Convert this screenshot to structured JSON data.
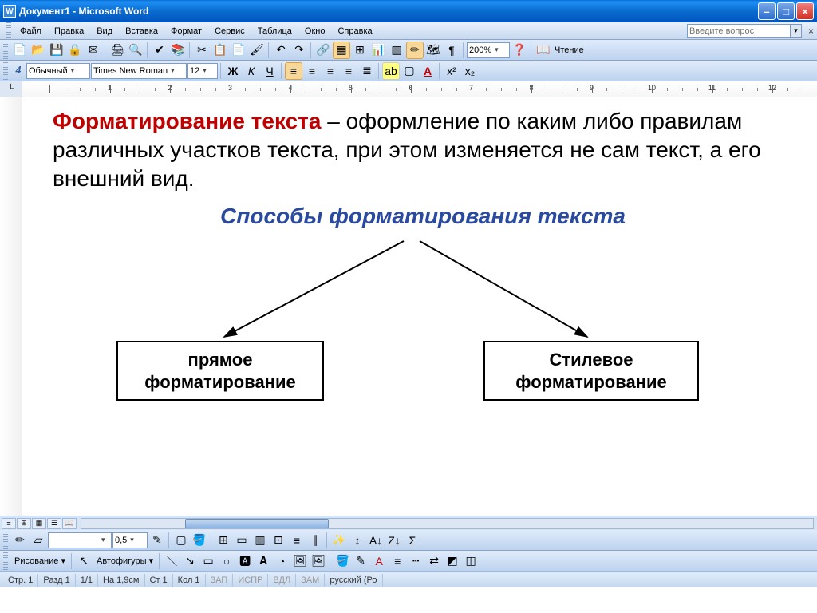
{
  "window": {
    "title": "Документ1 - Microsoft Word"
  },
  "menu": {
    "items": [
      "Файл",
      "Правка",
      "Вид",
      "Вставка",
      "Формат",
      "Сервис",
      "Таблица",
      "Окно",
      "Справка"
    ],
    "question_placeholder": "Введите вопрос"
  },
  "toolbar1": {
    "zoom": "200%",
    "reading": "Чтение"
  },
  "toolbar2": {
    "style_indicator": "4",
    "style": "Обычный",
    "font": "Times New Roman",
    "size": "12"
  },
  "document": {
    "title_span": "Форматирование текста",
    "body_text": " – оформление по каким либо правилам различных участков текста, при этом изменяется не сам текст, а его внешний вид.",
    "subtitle": "Способы форматирования текста",
    "box_left_l1": "прямое",
    "box_left_l2": "форматирование",
    "box_right_l1": "Стилевое",
    "box_right_l2": "форматирование"
  },
  "toolbar3": {
    "weight": "0,5"
  },
  "toolbar4": {
    "drawing": "Рисование",
    "autoshapes": "Автофигуры"
  },
  "status": {
    "page": "Стр. 1",
    "section": "Разд 1",
    "pages": "1/1",
    "at": "На 1,9см",
    "ln": "Ст 1",
    "col": "Кол 1",
    "rec": "ЗАП",
    "trk": "ИСПР",
    "ext": "ВДЛ",
    "ovr": "ЗАМ",
    "lang": "русский (Ро"
  },
  "ruler": {
    "max": 13
  }
}
